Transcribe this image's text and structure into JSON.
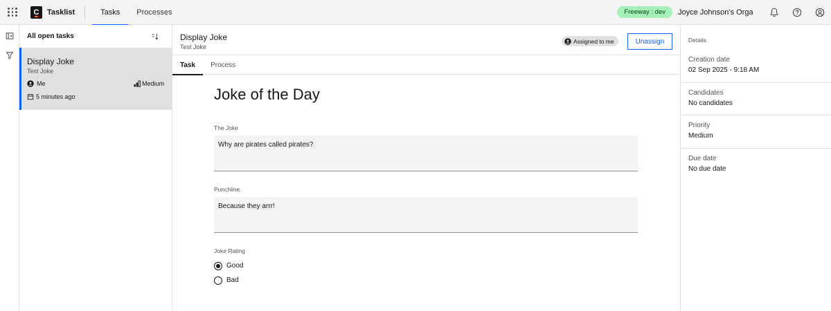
{
  "app": {
    "brand_name": "Tasklist",
    "logo_letter": "C"
  },
  "topnav": {
    "items": [
      {
        "label": "Tasks",
        "active": true
      },
      {
        "label": "Processes",
        "active": false
      }
    ]
  },
  "header": {
    "env_tag": "Freeway : dev",
    "org_name": "Joyce Johnson’s Orga..."
  },
  "tasklist": {
    "heading": "All open tasks",
    "tasks": [
      {
        "title": "Display Joke",
        "subtitle": "Test Joke",
        "assignee": "Me",
        "priority": "Medium",
        "created": "5 minutes ago"
      }
    ]
  },
  "main": {
    "title": "Display Joke",
    "subtitle": "Test Joke",
    "assigned_tag": "Assigned to me",
    "unassign_label": "Unassign",
    "tabs": [
      {
        "label": "Task",
        "active": true
      },
      {
        "label": "Process",
        "active": false
      }
    ],
    "form": {
      "title": "Joke of the Day",
      "joke_label": "The Joke",
      "joke_value": "Why are pirates called pirates?",
      "punchline_label": "Punchline",
      "punchline_value": "Because they arrr!",
      "rating_label": "Joke Rating",
      "rating_options": [
        {
          "label": "Good",
          "checked": true
        },
        {
          "label": "Bad",
          "checked": false
        }
      ]
    }
  },
  "details": {
    "heading": "Details",
    "sections": [
      {
        "label": "Creation date",
        "value": "02 Sep 2025 - 9:18 AM"
      },
      {
        "label": "Candidates",
        "value": "No candidates"
      },
      {
        "label": "Priority",
        "value": "Medium"
      },
      {
        "label": "Due date",
        "value": "No due date"
      }
    ]
  },
  "colors": {
    "accent": "#0f62fe",
    "env_tag_bg": "#a7f0ba",
    "selected_row": "#e0e0e0"
  }
}
